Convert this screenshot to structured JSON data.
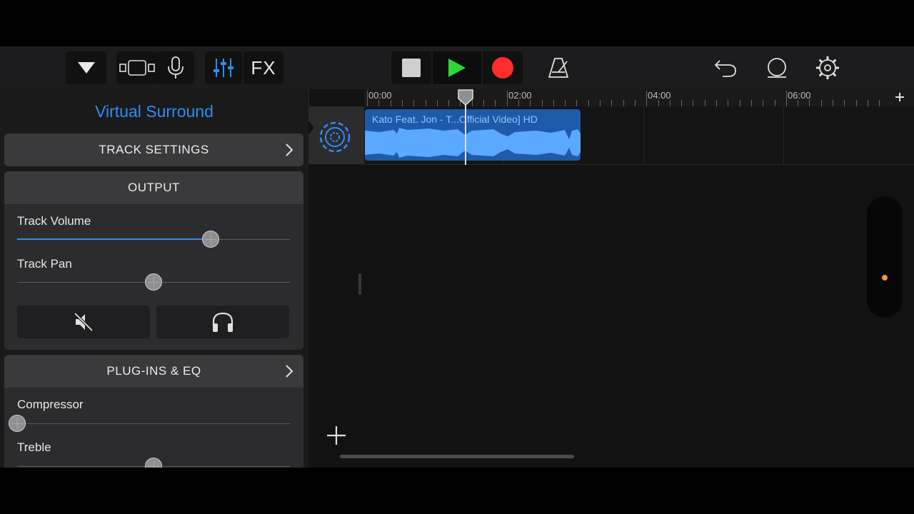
{
  "toolbar": {
    "buttons": [
      "browser-toggle",
      "track-view",
      "microphone",
      "mixer",
      "fx",
      "stop",
      "play",
      "record",
      "metronome",
      "undo",
      "loop",
      "settings"
    ],
    "fx_label": "FX",
    "colors": {
      "play": "#2bd93b",
      "record": "#ff2d2d",
      "accent": "#2f8cf5"
    }
  },
  "panel": {
    "title": "Virtual Surround",
    "track_settings_label": "TRACK SETTINGS",
    "output": {
      "header": "OUTPUT",
      "track_volume_label": "Track Volume",
      "track_volume_value": 0.71,
      "track_pan_label": "Track Pan",
      "track_pan_value": 0.5
    },
    "plugins": {
      "header": "PLUG-INS & EQ",
      "compressor_label": "Compressor",
      "compressor_value": 0.0,
      "treble_label": "Treble",
      "treble_value": 0.5
    }
  },
  "timeline": {
    "ruler_labels": [
      "00:00",
      "02:00",
      "04:00",
      "06:00"
    ],
    "region_title": "Kato Feat. Jon - T...Official Video] HD"
  }
}
